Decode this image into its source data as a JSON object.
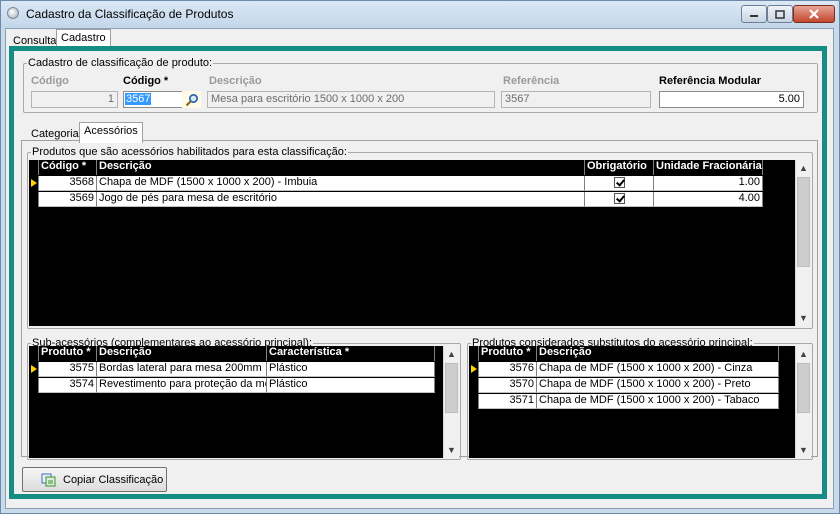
{
  "window": {
    "title": "Cadastro da Classificação de Produtos",
    "tabs": [
      {
        "label": "Consulta"
      },
      {
        "label": "Cadastro"
      }
    ]
  },
  "form": {
    "legend": "Cadastro de classificação de produto:",
    "codigo_label": "Código",
    "codigo_value": "1",
    "codigo_produto_label": "Código *",
    "codigo_produto_value": "3567",
    "descricao_label": "Descrição",
    "descricao_value": "Mesa para escritório 1500 x 1000 x 200",
    "referencia_label": "Referência",
    "referencia_value": "3567",
    "ref_modular_label": "Referência Modular",
    "ref_modular_value": "5.00"
  },
  "inner_tabs": [
    {
      "label": "Categorias"
    },
    {
      "label": "Acessórios"
    }
  ],
  "acessorios": {
    "legend": "Produtos que são acessórios habilitados para esta classificação:",
    "columns": [
      "Código *",
      "Descrição",
      "Obrigatório",
      "Unidade Fracionária"
    ],
    "rows": [
      {
        "codigo": "3568",
        "descricao": "Chapa de MDF (1500 x 1000 x 200) - Imbuia",
        "obrigatorio": true,
        "unidade": "1.00"
      },
      {
        "codigo": "3569",
        "descricao": "Jogo de pés para mesa de escritório",
        "obrigatorio": true,
        "unidade": "4.00"
      }
    ]
  },
  "sub_acessorios": {
    "legend": "Sub-acessórios (complementares ao acessório principal):",
    "columns": [
      "Produto *",
      "Descrição",
      "Característica *"
    ],
    "rows": [
      {
        "produto": "3575",
        "descricao": "Bordas lateral para mesa 200mm",
        "caracteristica": "Plástico"
      },
      {
        "produto": "3574",
        "descricao": "Revestimento para proteção da mesa",
        "caracteristica": "Plástico"
      }
    ]
  },
  "substitutos": {
    "legend": "Produtos considerados substitutos do acessório principal:",
    "columns": [
      "Produto *",
      "Descrição"
    ],
    "rows": [
      {
        "produto": "3576",
        "descricao": "Chapa de MDF (1500 x 1000 x 200) - Cinza"
      },
      {
        "produto": "3570",
        "descricao": "Chapa de MDF (1500 x 1000 x 200) - Preto"
      },
      {
        "produto": "3571",
        "descricao": "Chapa de MDF (1500 x 1000 x 200) - Tabaco"
      }
    ]
  },
  "footer": {
    "copy_button": "Copiar Classificação"
  },
  "icons": {
    "search": "search-icon",
    "copy": "copy-icon",
    "minimize": "minimize-icon",
    "maximize": "maximize-icon",
    "close": "close-icon"
  },
  "colors": {
    "accent_border": "#168d84",
    "grid_background": "#000000",
    "row_pointer": "#ffd400"
  }
}
